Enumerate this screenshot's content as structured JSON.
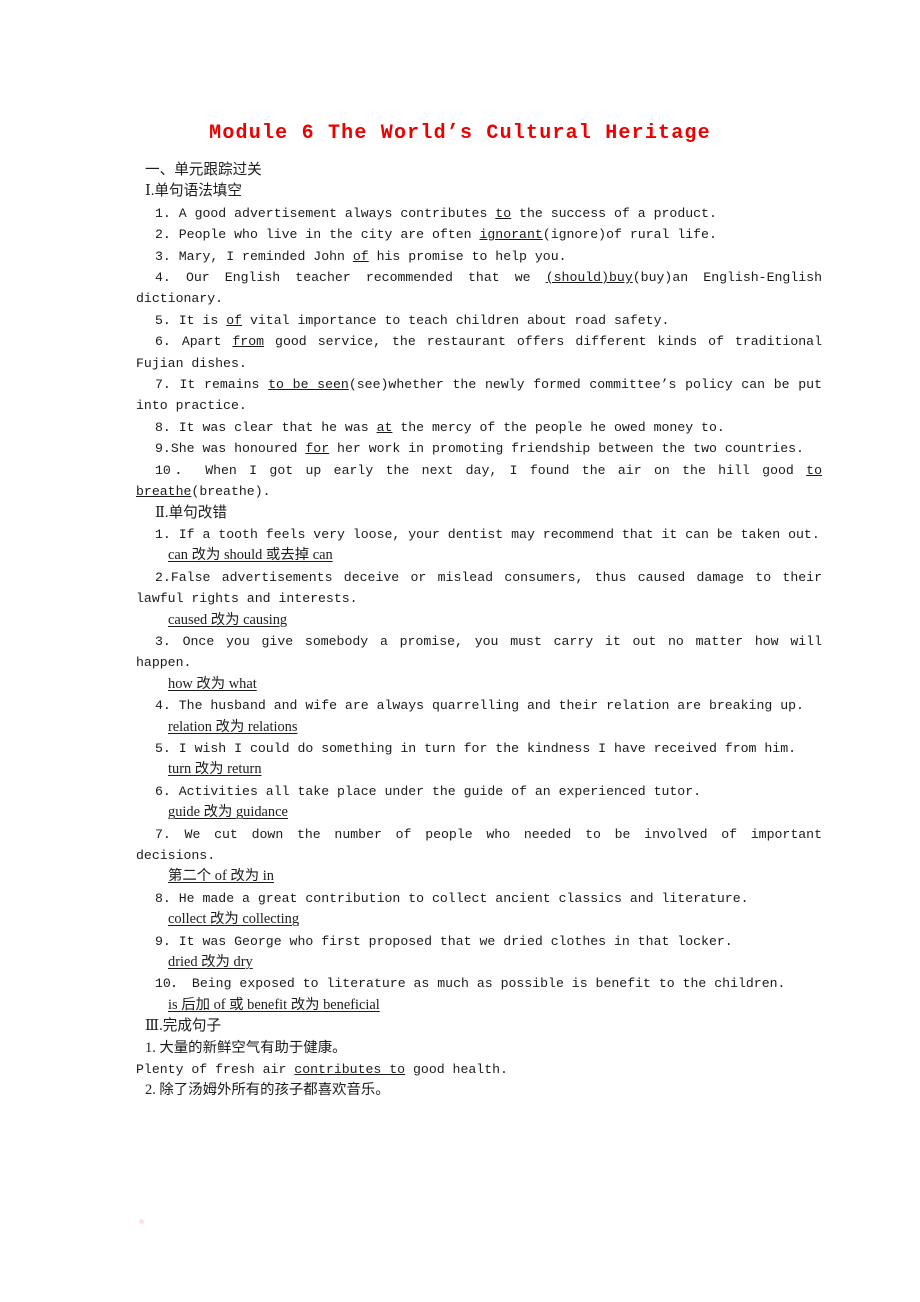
{
  "document": {
    "title": "Module 6  The World’s Cultural Heritage",
    "title_color": "#ee0000",
    "page_background": "#ffffff",
    "text_color": "#1d1d1d"
  },
  "section_part": "一、单元跟踪过关",
  "sections": [
    {
      "id": "section-1",
      "heading": "Ⅰ.单句语法填空",
      "items": [
        {
          "number": "1.",
          "pre": " A good advertisement always contributes ",
          "answer": "to",
          "post": " the success of a product."
        },
        {
          "number": "2.",
          "pre": " People who live in the city are often ",
          "answer": "ignorant",
          "post": "(ignore)of rural life."
        },
        {
          "number": "3.",
          "pre": " Mary, I reminded John ",
          "answer": "of",
          "post": " his promise to help you."
        },
        {
          "number": "4.",
          "pre": " Our English teacher recommended that we ",
          "answer": "(should)buy",
          "post": "(buy)an English-English dictionary."
        },
        {
          "number": "5.",
          "pre": " It is ",
          "answer": "of",
          "post": " vital importance to teach children about road safety."
        },
        {
          "number": "6.",
          "pre": " Apart ",
          "answer": "from",
          "post": " good service, the restaurant offers different kinds of traditional Fujian dishes."
        },
        {
          "number": "7.",
          "pre": " It remains ",
          "answer": "to be seen",
          "post": "(see)whether the newly formed committee’s policy can be put into practice."
        },
        {
          "number": "8.",
          "pre": " It was clear that he was ",
          "answer": "at",
          "post": " the mercy of the people he owed money to."
        },
        {
          "number": "9.",
          "pre": "She was honoured ",
          "answer": "for",
          "post": " her work in promoting friendship between the two countries."
        },
        {
          "number": "10．",
          "pre": " When I got up early the next day, I found the air on the hill good ",
          "answer": "to breathe",
          "post": "(breathe)."
        }
      ]
    },
    {
      "id": "section-2",
      "heading": "Ⅱ.单句改错",
      "items": [
        {
          "number": "1.",
          "sentence": " If a tooth feels very loose, your dentist may recommend that it can be taken out.",
          "answer": "can 改为 should 或去掉 can"
        },
        {
          "number": "2.",
          "sentence": "False advertisements deceive or mislead consumers, thus caused damage to their lawful rights and interests.",
          "answer": "caused 改为 causing"
        },
        {
          "number": "3.",
          "sentence": " Once you give somebody a promise, you must carry it out no matter how will happen.",
          "answer": "how 改为 what"
        },
        {
          "number": "4.",
          "sentence": " The husband and wife are always quarrelling and their relation are breaking up.",
          "answer": "relation 改为 relations"
        },
        {
          "number": "5.",
          "sentence": " I wish I could do something in turn for the kindness I have received from him.",
          "answer": "turn 改为 return"
        },
        {
          "number": "6.",
          "sentence": " Activities all take place under the guide of an experienced tutor.",
          "answer": "guide 改为 guidance"
        },
        {
          "number": "7.",
          "sentence": " We cut  down the number of people who needed to be  involved of important decisions.",
          "answer": "第二个 of 改为 in"
        },
        {
          "number": "8.",
          "sentence": " He made a great contribution to collect ancient classics and literature.",
          "answer": "collect 改为 collecting"
        },
        {
          "number": "9.",
          "sentence": " It was George who first proposed that we dried clothes in that locker.",
          "answer": "dried 改为 dry"
        },
        {
          "number": "10．",
          "sentence": " Being exposed to literature as much as possible is benefit to the children.",
          "answer": "is 后加 of 或 benefit 改为 beneficial"
        }
      ]
    },
    {
      "id": "section-3",
      "heading": "Ⅲ.完成句子",
      "items": [
        {
          "number": "1.",
          "chinese": " 大量的新鲜空气有助于健康。",
          "english_pre": "Plenty of fresh air ",
          "english_answer": "contributes to",
          "english_post": " good health."
        },
        {
          "number": "2.",
          "chinese": " 除了汤姆外所有的孩子都喜欢音乐。",
          "english_pre": "",
          "english_answer": "",
          "english_post": ""
        }
      ]
    }
  ]
}
